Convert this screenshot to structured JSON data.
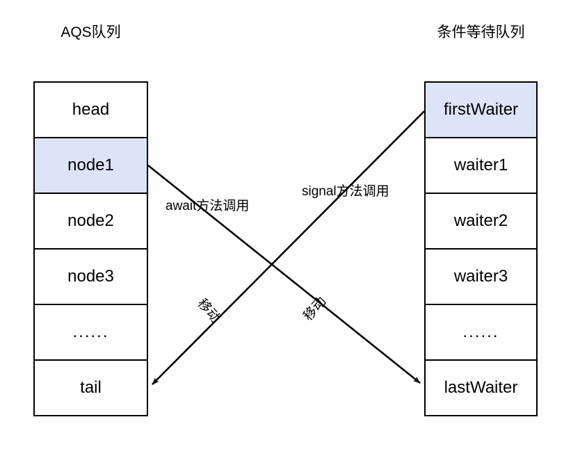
{
  "diagram": {
    "title_left": "AQS队列",
    "title_right": "条件等待队列",
    "highlight_color": "#dce4f7",
    "line_color": "#000000",
    "background": "#ffffff"
  },
  "left_queue": {
    "name": "AQS队列",
    "cells": [
      {
        "label": "head",
        "highlighted": false
      },
      {
        "label": "node1",
        "highlighted": true
      },
      {
        "label": "node2",
        "highlighted": false
      },
      {
        "label": "node3",
        "highlighted": false
      },
      {
        "label": "......",
        "highlighted": false
      },
      {
        "label": "tail",
        "highlighted": false
      }
    ]
  },
  "right_queue": {
    "name": "条件等待队列",
    "cells": [
      {
        "label": "firstWaiter",
        "highlighted": true
      },
      {
        "label": "waiter1",
        "highlighted": false
      },
      {
        "label": "waiter2",
        "highlighted": false
      },
      {
        "label": "waiter3",
        "highlighted": false
      },
      {
        "label": "......",
        "highlighted": false
      },
      {
        "label": "lastWaiter",
        "highlighted": false
      }
    ]
  },
  "connectors": [
    {
      "id": "await-arrow",
      "label": "await方法调用",
      "sub_label": "移动",
      "from": "node1",
      "to": "lastWaiter",
      "direction": "left-to-right-down"
    },
    {
      "id": "signal-arrow",
      "label": "signal方法调用",
      "sub_label": "移动",
      "from": "firstWaiter",
      "to": "tail",
      "direction": "right-to-left-down"
    }
  ],
  "labels": {
    "await_call": "await方法调用",
    "signal_call": "signal方法调用",
    "move_left": "移动",
    "move_right": "移动"
  }
}
